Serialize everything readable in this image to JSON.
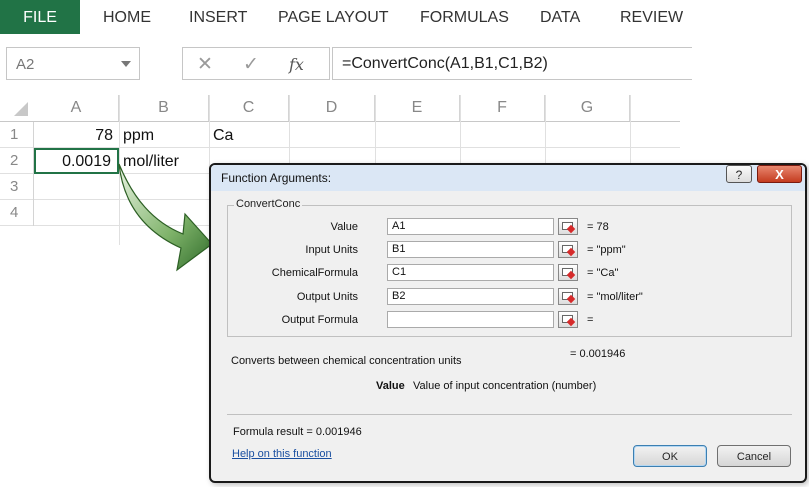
{
  "ribbon": {
    "tabs": [
      "FILE",
      "HOME",
      "INSERT",
      "PAGE LAYOUT",
      "FORMULAS",
      "DATA",
      "REVIEW"
    ],
    "active_color": "#217346"
  },
  "formula_bar": {
    "name_box": "A2",
    "cancel_icon": "✕",
    "enter_icon": "✓",
    "fx_icon": "fx",
    "formula": "=ConvertConc(A1,B1,C1,B2)"
  },
  "sheet": {
    "columns": [
      "A",
      "B",
      "C",
      "D",
      "E",
      "F",
      "G"
    ],
    "rows": [
      "1",
      "2",
      "3",
      "4"
    ],
    "cells": {
      "A1": "78",
      "B1": "ppm",
      "C1": "Ca",
      "A2": "0.0019",
      "B2": "mol/liter"
    }
  },
  "dialog": {
    "title": "Function Arguments:",
    "help_label": "?",
    "close_label": "X",
    "group_label": "ConvertConc",
    "args": [
      {
        "label": "Value",
        "input": "A1",
        "result": "= 78"
      },
      {
        "label": "Input Units",
        "input": "B1",
        "result": "= \"ppm\""
      },
      {
        "label": "ChemicalFormula",
        "input": "C1",
        "result": "= \"Ca\""
      },
      {
        "label": "Output Units",
        "input": "B2",
        "result": "= \"mol/liter\""
      },
      {
        "label": "Output Formula",
        "input": "",
        "result": "="
      }
    ],
    "overall_result": "= 0.001946",
    "description": "Converts between chemical concentration units",
    "param_name": "Value",
    "param_desc": "Value of input concentration (number)",
    "formula_result": "Formula result = 0.001946",
    "help_link": "Help on this function",
    "ok_label": "OK",
    "cancel_label": "Cancel"
  }
}
